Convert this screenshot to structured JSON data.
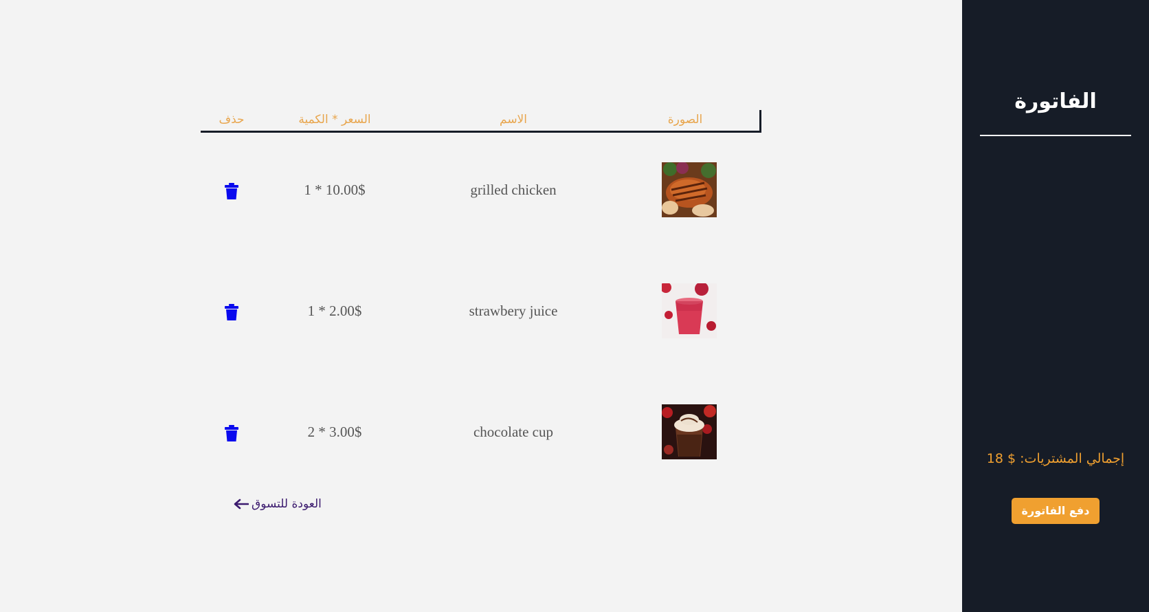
{
  "sidebar": {
    "title": "الفاتورة",
    "total_label": "إجمالي المشتريات: $ 18",
    "pay_button": "دفع الفاتورة"
  },
  "table": {
    "headers": {
      "image": "الصورة",
      "name": "الاسم",
      "price_qty": "السعر * الكمية",
      "delete": "حذف"
    },
    "rows": [
      {
        "name": "grilled chicken",
        "price_qty": "1 * 10.00$",
        "image_icon": "grilled-chicken-image"
      },
      {
        "name": "strawbery juice",
        "price_qty": "1 * 2.00$",
        "image_icon": "strawberry-juice-image"
      },
      {
        "name": "chocolate cup",
        "price_qty": "2 * 3.00$",
        "image_icon": "chocolate-cup-image"
      }
    ]
  },
  "back_link": {
    "label": "العودة للتسوق",
    "icon": "arrow-left-icon"
  },
  "colors": {
    "sidebar_bg": "#161c27",
    "accent": "#f0a030",
    "header_text": "#e8a54c",
    "delete_icon": "#0a0aee",
    "link": "#3b1a6e",
    "page_bg": "#f3f3f3"
  }
}
